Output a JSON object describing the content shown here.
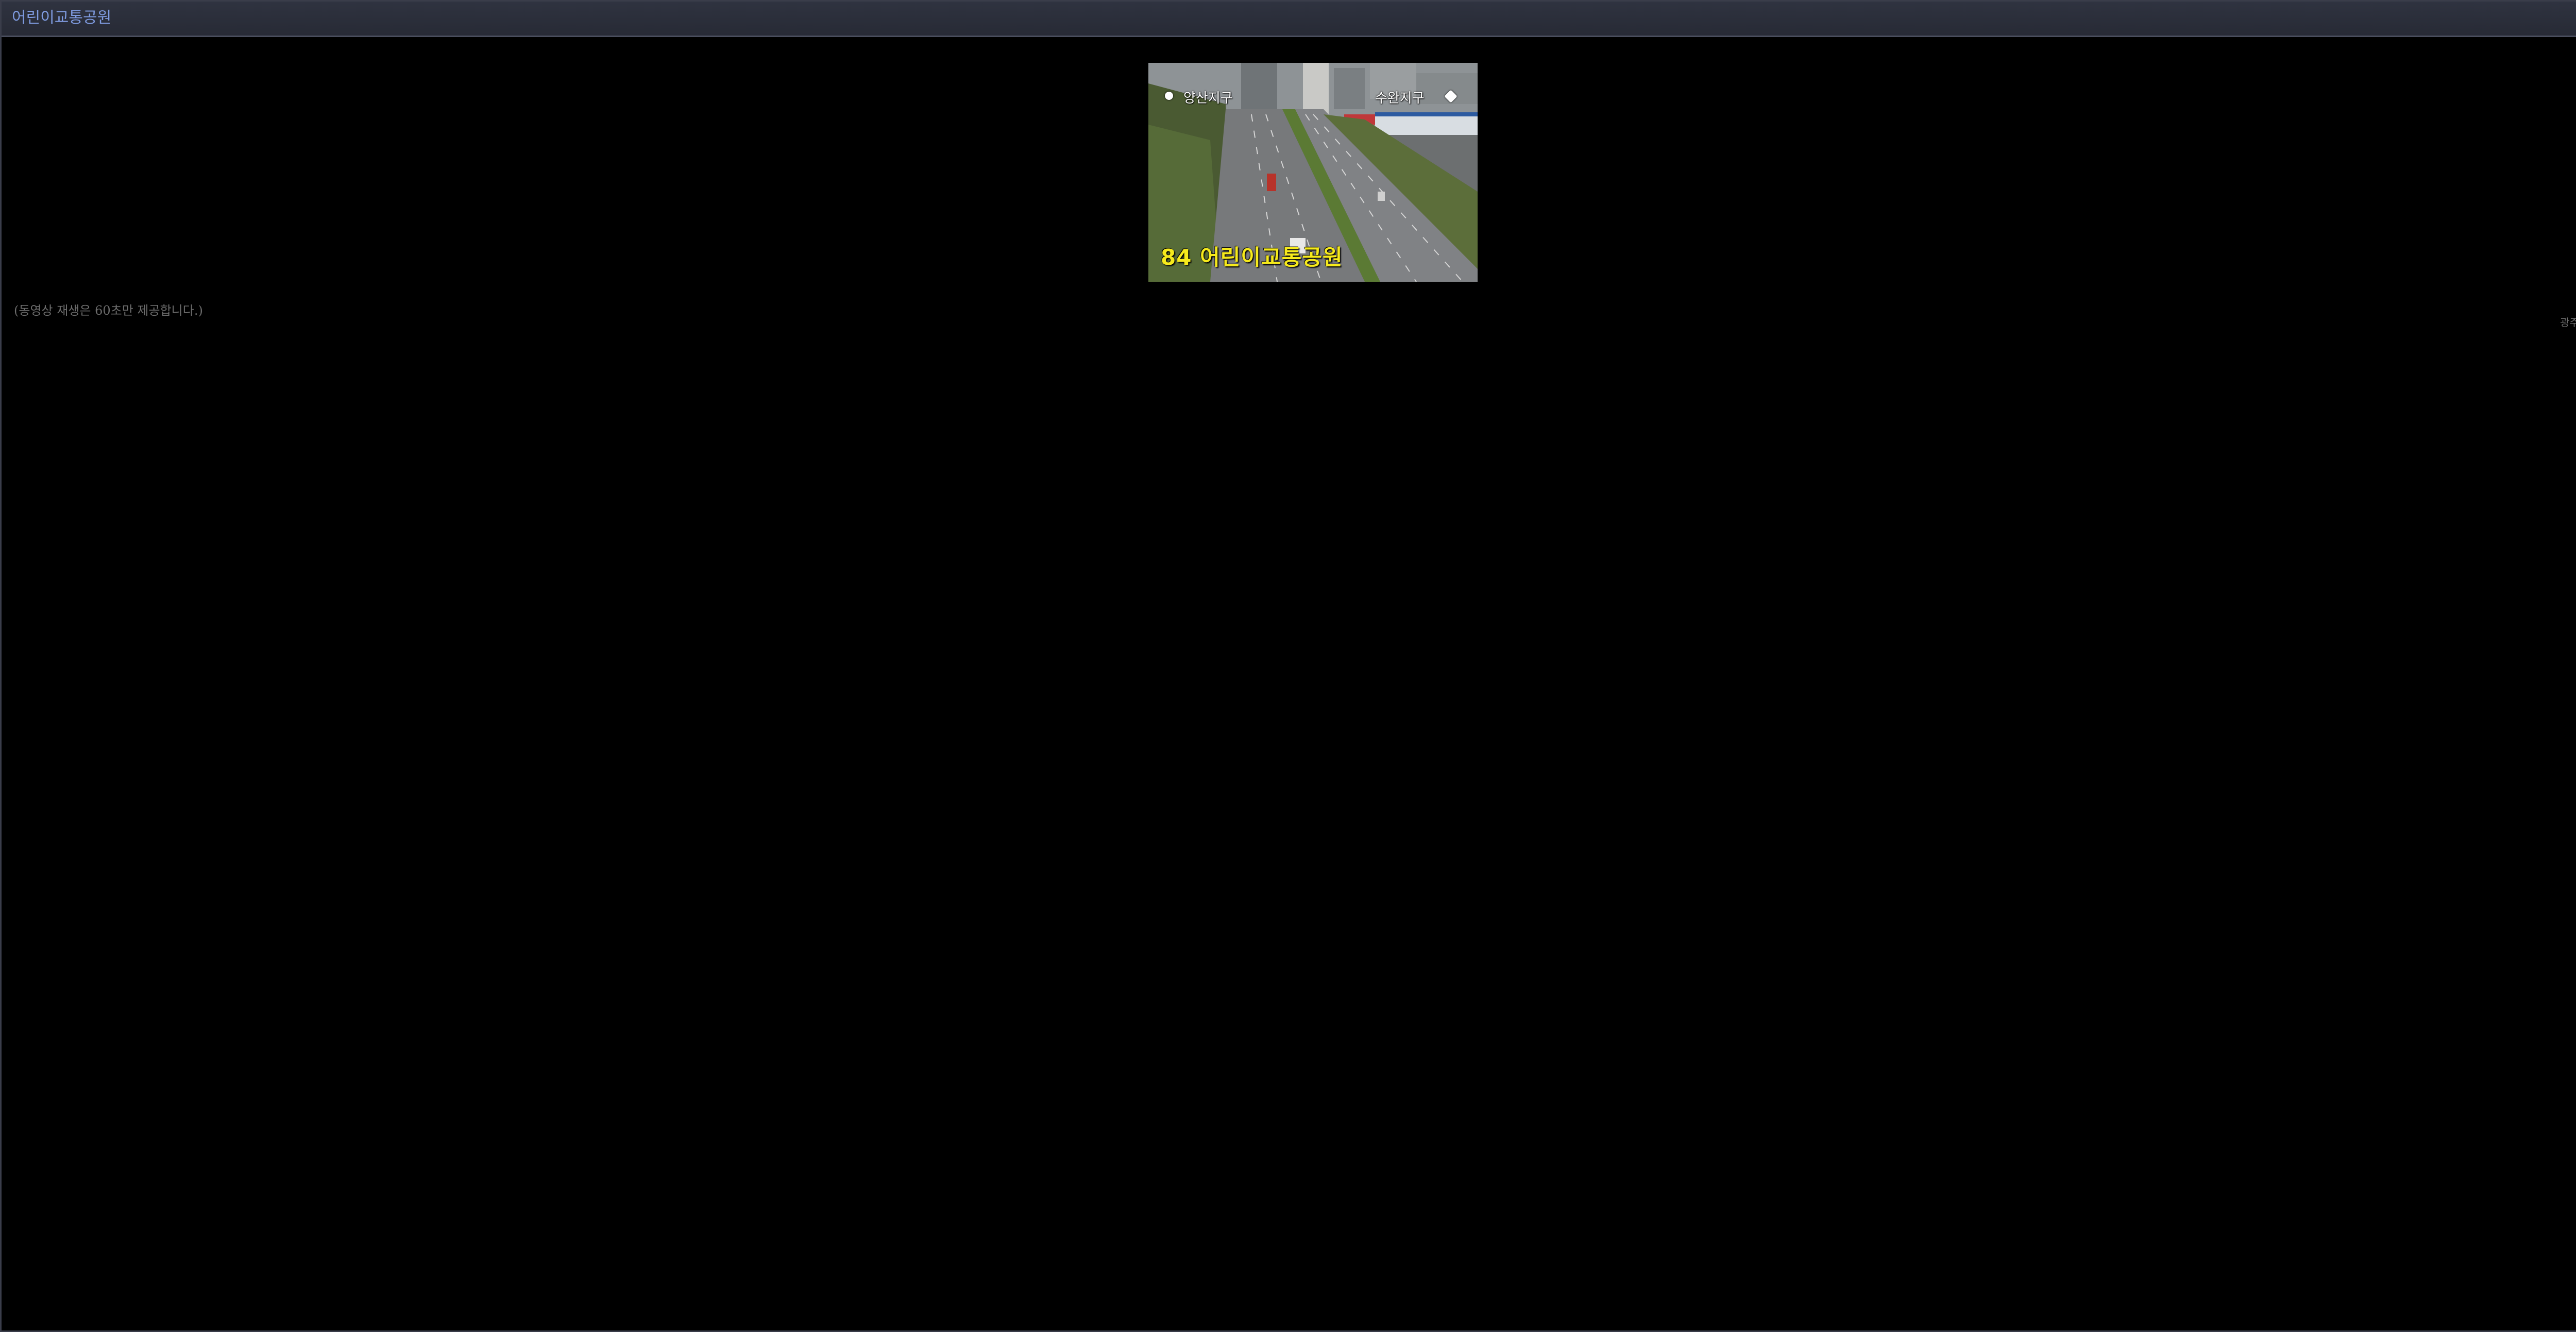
{
  "window": {
    "title": "어린이교통공원",
    "close_icon": "close-icon"
  },
  "video": {
    "direction_left": "양산지구",
    "direction_right": "수완지구",
    "caption": "84 어린이교통공원"
  },
  "notice": "(동영상 재생은 60초만 제공합니다.)",
  "source": "광주광역시",
  "colors": {
    "background": "#000000",
    "title_text": "#7f9be0",
    "caption_text": "#f6ea1c",
    "notice_text": "#6c6c6c"
  }
}
